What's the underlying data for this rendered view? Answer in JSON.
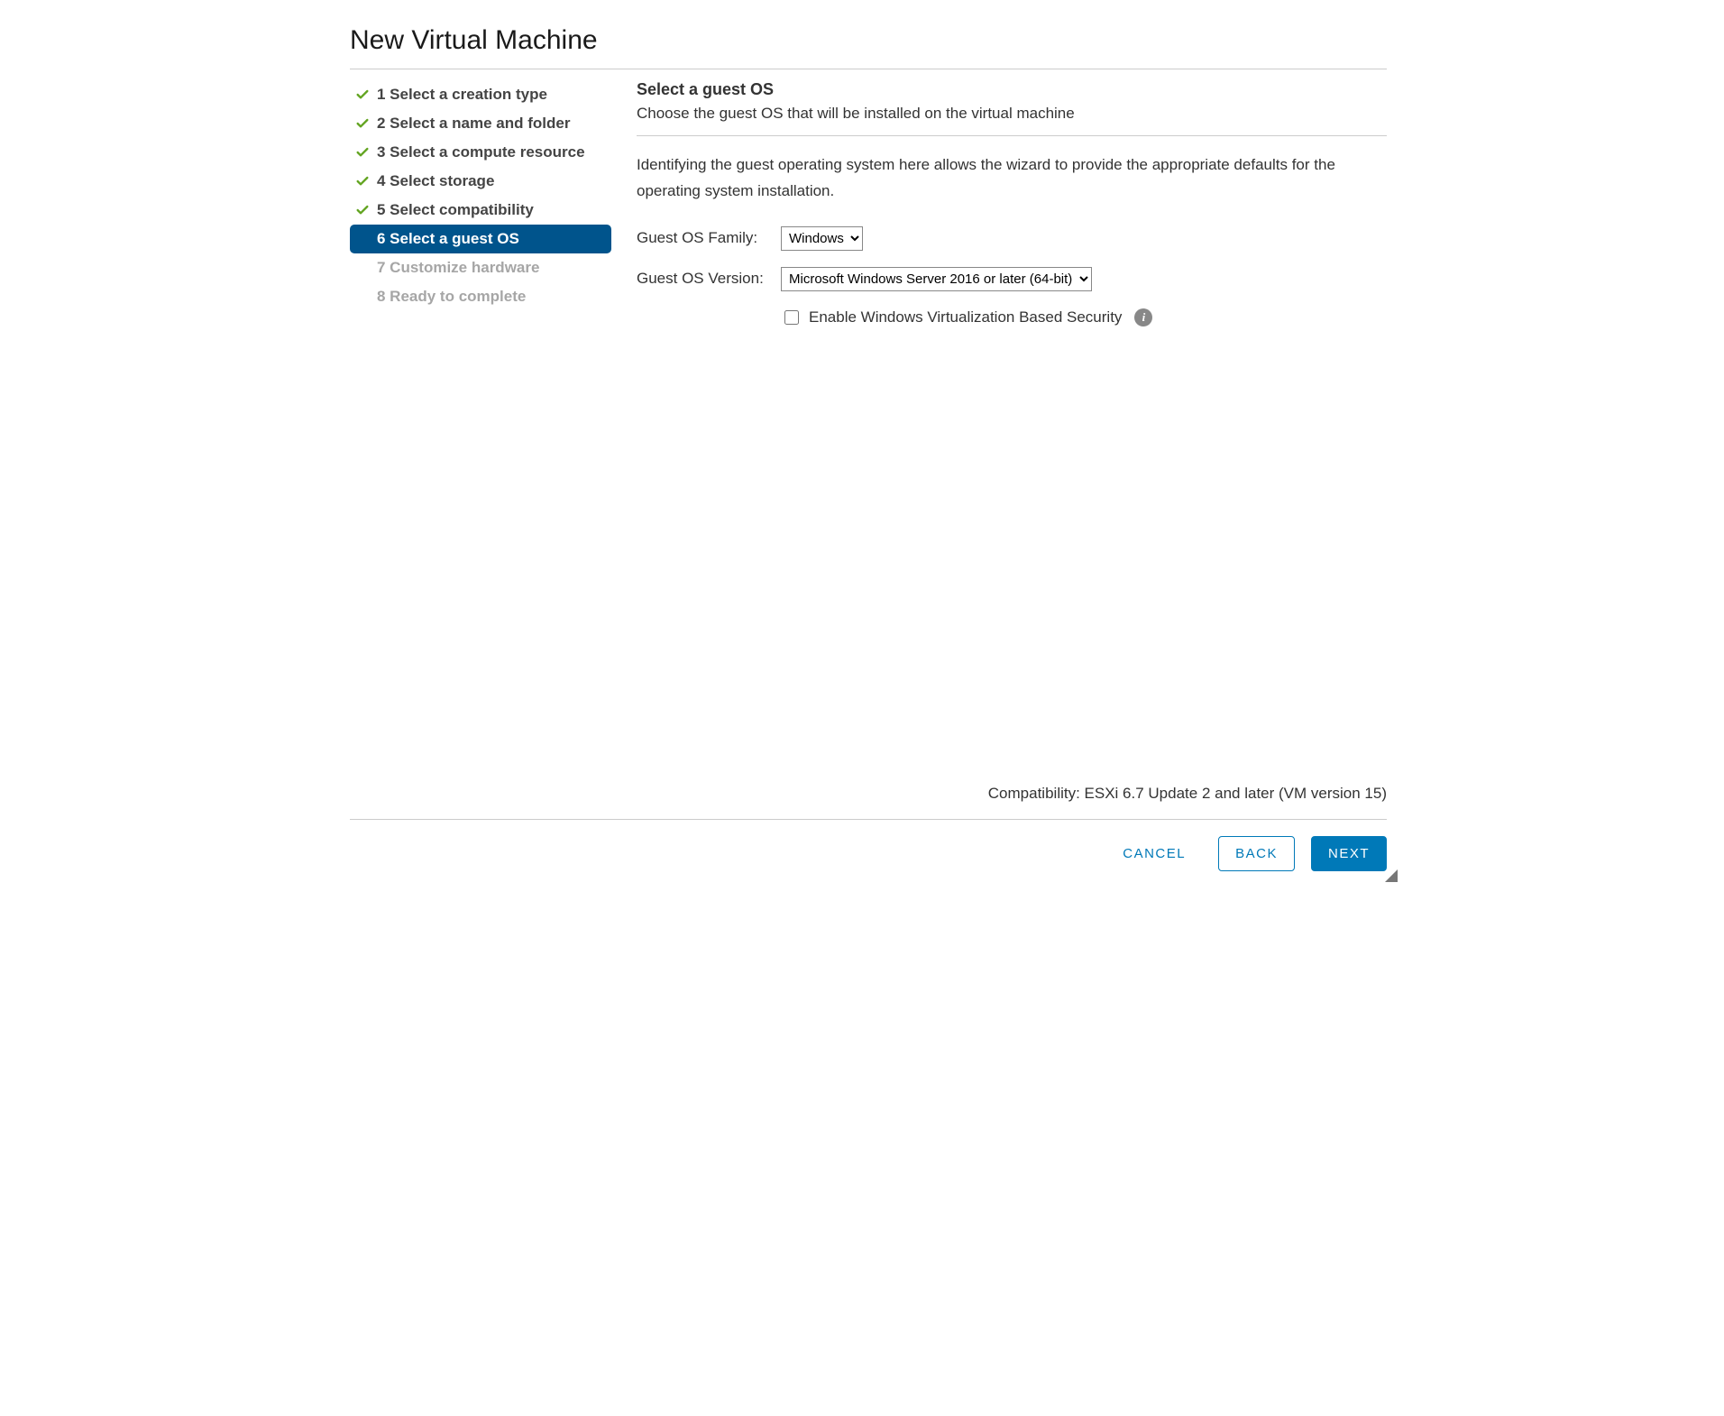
{
  "dialog": {
    "title": "New Virtual Machine"
  },
  "steps": [
    {
      "num": "1",
      "label": "Select a creation type",
      "state": "done"
    },
    {
      "num": "2",
      "label": "Select a name and folder",
      "state": "done"
    },
    {
      "num": "3",
      "label": "Select a compute resource",
      "state": "done"
    },
    {
      "num": "4",
      "label": "Select storage",
      "state": "done"
    },
    {
      "num": "5",
      "label": "Select compatibility",
      "state": "done"
    },
    {
      "num": "6",
      "label": "Select a guest OS",
      "state": "current"
    },
    {
      "num": "7",
      "label": "Customize hardware",
      "state": "future"
    },
    {
      "num": "8",
      "label": "Ready to complete",
      "state": "future"
    }
  ],
  "content": {
    "title": "Select a guest OS",
    "subtitle": "Choose the guest OS that will be installed on the virtual machine",
    "description": "Identifying the guest operating system here allows the wizard to provide the appropriate defaults for the operating system installation.",
    "family_label": "Guest OS Family:",
    "family_value": "Windows",
    "version_label": "Guest OS Version:",
    "version_value": "Microsoft Windows Server 2016 or later (64-bit)",
    "vbs_label": "Enable Windows Virtualization Based Security",
    "vbs_checked": false,
    "compat": "Compatibility: ESXi 6.7 Update 2 and later (VM version 15)"
  },
  "footer": {
    "cancel": "CANCEL",
    "back": "BACK",
    "next": "NEXT"
  },
  "icons": {
    "check": "check-icon",
    "info": "info-icon",
    "grip": "resize-grip-icon"
  },
  "colors": {
    "accent": "#0079b8",
    "step_active_bg": "#00548c",
    "check_green": "#62a420"
  }
}
